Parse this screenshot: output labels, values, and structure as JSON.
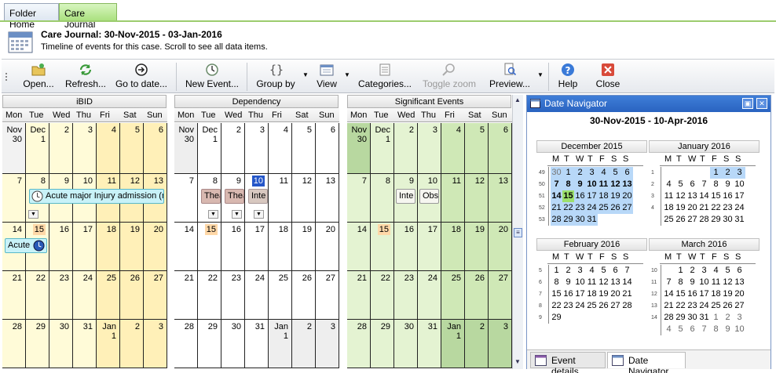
{
  "tabs": [
    "Folder Home",
    "Care Journal"
  ],
  "header": {
    "title": "Care Journal: 30-Nov-2015 - 03-Jan-2016",
    "subtitle": "Timeline of events for this case.  Scroll to see all data items."
  },
  "toolbar": {
    "open": "Open...",
    "refresh": "Refresh...",
    "goto": "Go to date...",
    "new_event": "New Event...",
    "group_by": "Group by",
    "view": "View",
    "categories": "Categories...",
    "toggle_zoom": "Toggle zoom",
    "preview": "Preview...",
    "help": "Help",
    "close": "Close"
  },
  "weekdays": [
    "Mon",
    "Tue",
    "Wed",
    "Thu",
    "Fri",
    "Sat",
    "Sun"
  ],
  "groups": [
    "iBID",
    "Dependency",
    "Significant Events"
  ],
  "weeks": [
    [
      "Nov 30",
      "Dec 1",
      "2",
      "3",
      "4",
      "5",
      "6"
    ],
    [
      "7",
      "8",
      "9",
      "10",
      "11",
      "12",
      "13"
    ],
    [
      "14",
      "15",
      "16",
      "17",
      "18",
      "19",
      "20"
    ],
    [
      "21",
      "22",
      "23",
      "24",
      "25",
      "26",
      "27"
    ],
    [
      "28",
      "29",
      "30",
      "31",
      "Jan 1",
      "2",
      "3"
    ]
  ],
  "events": {
    "ibid_1": "Acute major Injury admission (r",
    "ibid_2": "Acute",
    "dep_1": "Thea",
    "dep_2": "Thea",
    "dep_3": "Inte",
    "sig_1": "Inte",
    "sig_2": "Obse"
  },
  "navigator": {
    "title": "Date Navigator",
    "range": "30-Nov-2015 - 10-Apr-2016",
    "dow": [
      "M",
      "T",
      "W",
      "T",
      "F",
      "S",
      "S"
    ],
    "months": [
      {
        "name": "December 2015",
        "weeks": [
          "49",
          "50",
          "51",
          "52",
          "53"
        ],
        "rows": [
          [
            "30",
            "1",
            "2",
            "3",
            "4",
            "5",
            "6"
          ],
          [
            "7",
            "8",
            "9",
            "10",
            "11",
            "12",
            "13"
          ],
          [
            "14",
            "15",
            "16",
            "17",
            "18",
            "19",
            "20"
          ],
          [
            "21",
            "22",
            "23",
            "24",
            "25",
            "26",
            "27"
          ],
          [
            "28",
            "29",
            "30",
            "31",
            "",
            "",
            ""
          ]
        ]
      },
      {
        "name": "January 2016",
        "weeks": [
          "1",
          "2",
          "3",
          "4"
        ],
        "rows": [
          [
            "",
            "",
            "",
            "",
            "1",
            "2",
            "3"
          ],
          [
            "4",
            "5",
            "6",
            "7",
            "8",
            "9",
            "10"
          ],
          [
            "11",
            "12",
            "13",
            "14",
            "15",
            "16",
            "17"
          ],
          [
            "18",
            "19",
            "20",
            "21",
            "22",
            "23",
            "24"
          ],
          [
            "25",
            "26",
            "27",
            "28",
            "29",
            "30",
            "31"
          ]
        ]
      },
      {
        "name": "February 2016",
        "weeks": [
          "5",
          "6",
          "7",
          "8",
          "9"
        ],
        "rows": [
          [
            "1",
            "2",
            "3",
            "4",
            "5",
            "6",
            "7"
          ],
          [
            "8",
            "9",
            "10",
            "11",
            "12",
            "13",
            "14"
          ],
          [
            "15",
            "16",
            "17",
            "18",
            "19",
            "20",
            "21"
          ],
          [
            "22",
            "23",
            "24",
            "25",
            "26",
            "27",
            "28"
          ],
          [
            "29",
            "",
            "",
            "",
            "",
            "",
            ""
          ]
        ]
      },
      {
        "name": "March 2016",
        "weeks": [
          "10",
          "11",
          "12",
          "13",
          "14"
        ],
        "rows": [
          [
            "",
            "1",
            "2",
            "3",
            "4",
            "5",
            "6"
          ],
          [
            "7",
            "8",
            "9",
            "10",
            "11",
            "12",
            "13"
          ],
          [
            "14",
            "15",
            "16",
            "17",
            "18",
            "19",
            "20"
          ],
          [
            "21",
            "22",
            "23",
            "24",
            "25",
            "26",
            "27"
          ],
          [
            "28",
            "29",
            "30",
            "31",
            "1",
            "2",
            "3"
          ],
          [
            "4",
            "5",
            "6",
            "7",
            "8",
            "9",
            "10"
          ]
        ]
      }
    ],
    "bottom_tabs": [
      "Event details",
      "Date Navigator"
    ]
  }
}
